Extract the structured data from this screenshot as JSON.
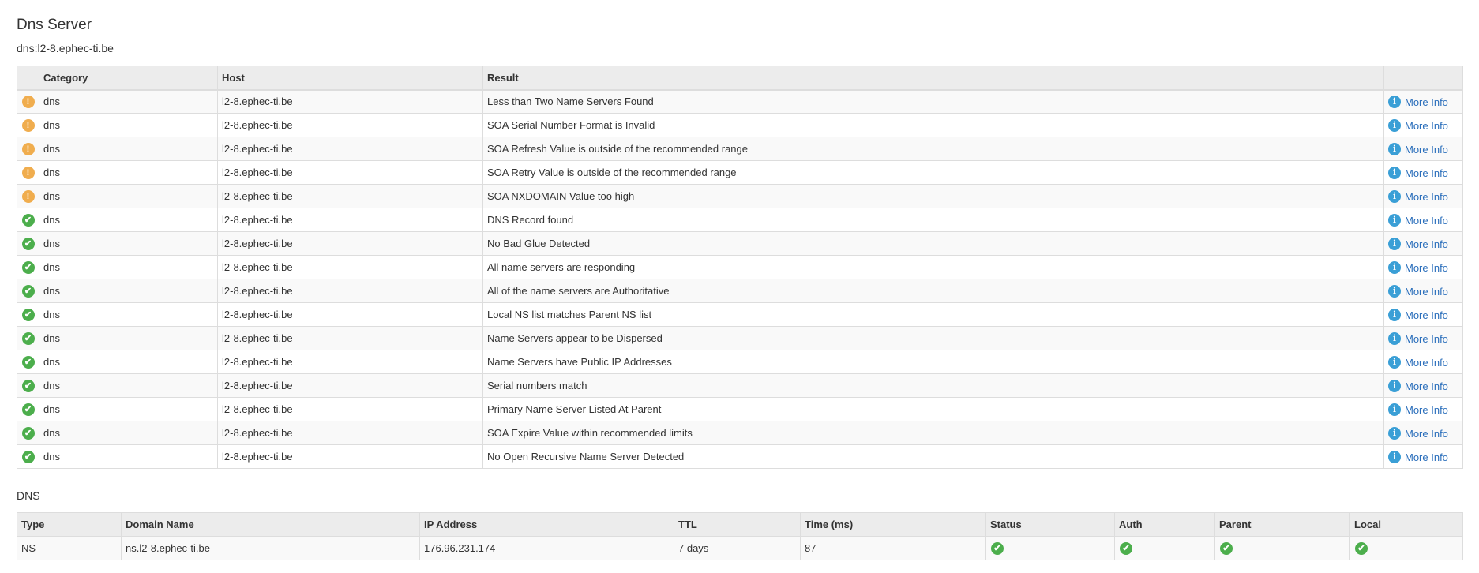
{
  "header": {
    "title": "Dns Server",
    "subtitle": "dns:l2-8.ephec-ti.be"
  },
  "results_table": {
    "columns": [
      "",
      "Category",
      "Host",
      "Result",
      ""
    ],
    "rows": [
      {
        "status": "warning",
        "category": "dns",
        "host": "l2-8.ephec-ti.be",
        "result": "Less than Two Name Servers Found",
        "link": "More Info"
      },
      {
        "status": "warning",
        "category": "dns",
        "host": "l2-8.ephec-ti.be",
        "result": "SOA Serial Number Format is Invalid",
        "link": "More Info"
      },
      {
        "status": "warning",
        "category": "dns",
        "host": "l2-8.ephec-ti.be",
        "result": "SOA Refresh Value is outside of the recommended range",
        "link": "More Info"
      },
      {
        "status": "warning",
        "category": "dns",
        "host": "l2-8.ephec-ti.be",
        "result": "SOA Retry Value is outside of the recommended range",
        "link": "More Info"
      },
      {
        "status": "warning",
        "category": "dns",
        "host": "l2-8.ephec-ti.be",
        "result": "SOA NXDOMAIN Value too high",
        "link": "More Info"
      },
      {
        "status": "ok",
        "category": "dns",
        "host": "l2-8.ephec-ti.be",
        "result": "DNS Record found",
        "link": "More Info"
      },
      {
        "status": "ok",
        "category": "dns",
        "host": "l2-8.ephec-ti.be",
        "result": "No Bad Glue Detected",
        "link": "More Info"
      },
      {
        "status": "ok",
        "category": "dns",
        "host": "l2-8.ephec-ti.be",
        "result": "All name servers are responding",
        "link": "More Info"
      },
      {
        "status": "ok",
        "category": "dns",
        "host": "l2-8.ephec-ti.be",
        "result": "All of the name servers are Authoritative",
        "link": "More Info"
      },
      {
        "status": "ok",
        "category": "dns",
        "host": "l2-8.ephec-ti.be",
        "result": "Local NS list matches Parent NS list",
        "link": "More Info"
      },
      {
        "status": "ok",
        "category": "dns",
        "host": "l2-8.ephec-ti.be",
        "result": "Name Servers appear to be Dispersed",
        "link": "More Info"
      },
      {
        "status": "ok",
        "category": "dns",
        "host": "l2-8.ephec-ti.be",
        "result": "Name Servers have Public IP Addresses",
        "link": "More Info"
      },
      {
        "status": "ok",
        "category": "dns",
        "host": "l2-8.ephec-ti.be",
        "result": "Serial numbers match",
        "link": "More Info"
      },
      {
        "status": "ok",
        "category": "dns",
        "host": "l2-8.ephec-ti.be",
        "result": "Primary Name Server Listed At Parent",
        "link": "More Info"
      },
      {
        "status": "ok",
        "category": "dns",
        "host": "l2-8.ephec-ti.be",
        "result": "SOA Expire Value within recommended limits",
        "link": "More Info"
      },
      {
        "status": "ok",
        "category": "dns",
        "host": "l2-8.ephec-ti.be",
        "result": "No Open Recursive Name Server Detected",
        "link": "More Info"
      }
    ]
  },
  "dns_section": {
    "label": "DNS",
    "columns": [
      "Type",
      "Domain Name",
      "IP Address",
      "TTL",
      "Time (ms)",
      "Status",
      "Auth",
      "Parent",
      "Local"
    ],
    "rows": [
      {
        "type": "NS",
        "domain": "ns.l2-8.ephec-ti.be",
        "ip": "176.96.231.174",
        "ttl": "7 days",
        "time_ms": "87",
        "status": "ok",
        "auth": "ok",
        "parent": "ok",
        "local": "ok"
      }
    ]
  },
  "colors": {
    "warning": "#f0ad4e",
    "ok": "#4cae4c",
    "info": "#3a9fd6",
    "link": "#2a6ebb"
  },
  "icons": {
    "warning": "exclamation-circle-icon",
    "ok": "check-circle-icon",
    "info": "info-circle-icon"
  }
}
